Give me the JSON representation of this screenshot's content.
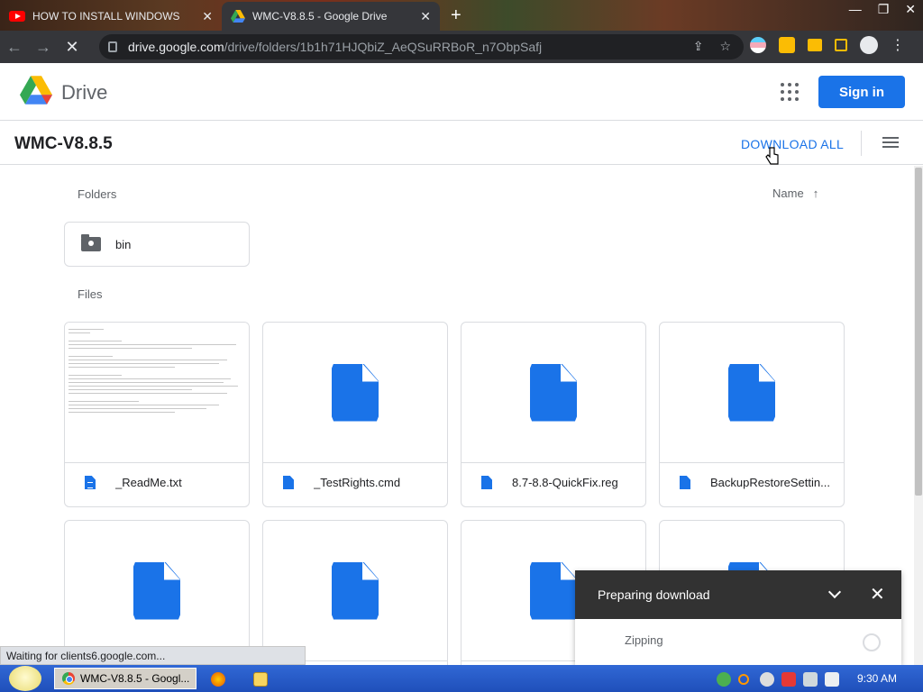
{
  "browser": {
    "tabs": [
      {
        "label": "HOW TO INSTALL WINDOWS",
        "active": false
      },
      {
        "label": "WMC-V8.8.5 - Google Drive",
        "active": true
      }
    ],
    "new_tab": "+",
    "url_host": "drive.google.com",
    "url_path": "/drive/folders/1b1h71HJQbiZ_AeQSuRRBoR_n7ObpSafj"
  },
  "header": {
    "app_name": "Drive",
    "signin_label": "Sign in"
  },
  "folder": {
    "title": "WMC-V8.8.5",
    "download_all_label": "DOWNLOAD ALL"
  },
  "sections": {
    "folders_label": "Folders",
    "files_label": "Files",
    "sort_label": "Name",
    "sort_arrow": "↑"
  },
  "folders": [
    {
      "name": "bin"
    }
  ],
  "files": [
    {
      "name": "_ReadMe.txt",
      "preview": "text"
    },
    {
      "name": "_TestRights.cmd",
      "preview": "icon"
    },
    {
      "name": "8.7-8.8-QuickFix.reg",
      "preview": "icon"
    },
    {
      "name": "BackupRestoreSettin...",
      "preview": "icon"
    },
    {
      "name": "",
      "preview": "icon"
    },
    {
      "name": "",
      "preview": "icon"
    },
    {
      "name": "",
      "preview": "icon"
    },
    {
      "name": "",
      "preview": "icon"
    }
  ],
  "download_panel": {
    "title": "Preparing download",
    "item_status": "Zipping"
  },
  "status_bar": "Waiting for clients6.google.com...",
  "taskbar": {
    "task_label": "WMC-V8.8.5 - Googl...",
    "clock": "9:30 AM"
  },
  "colors": {
    "accent": "#1a73e8",
    "panel_header": "#323232"
  }
}
